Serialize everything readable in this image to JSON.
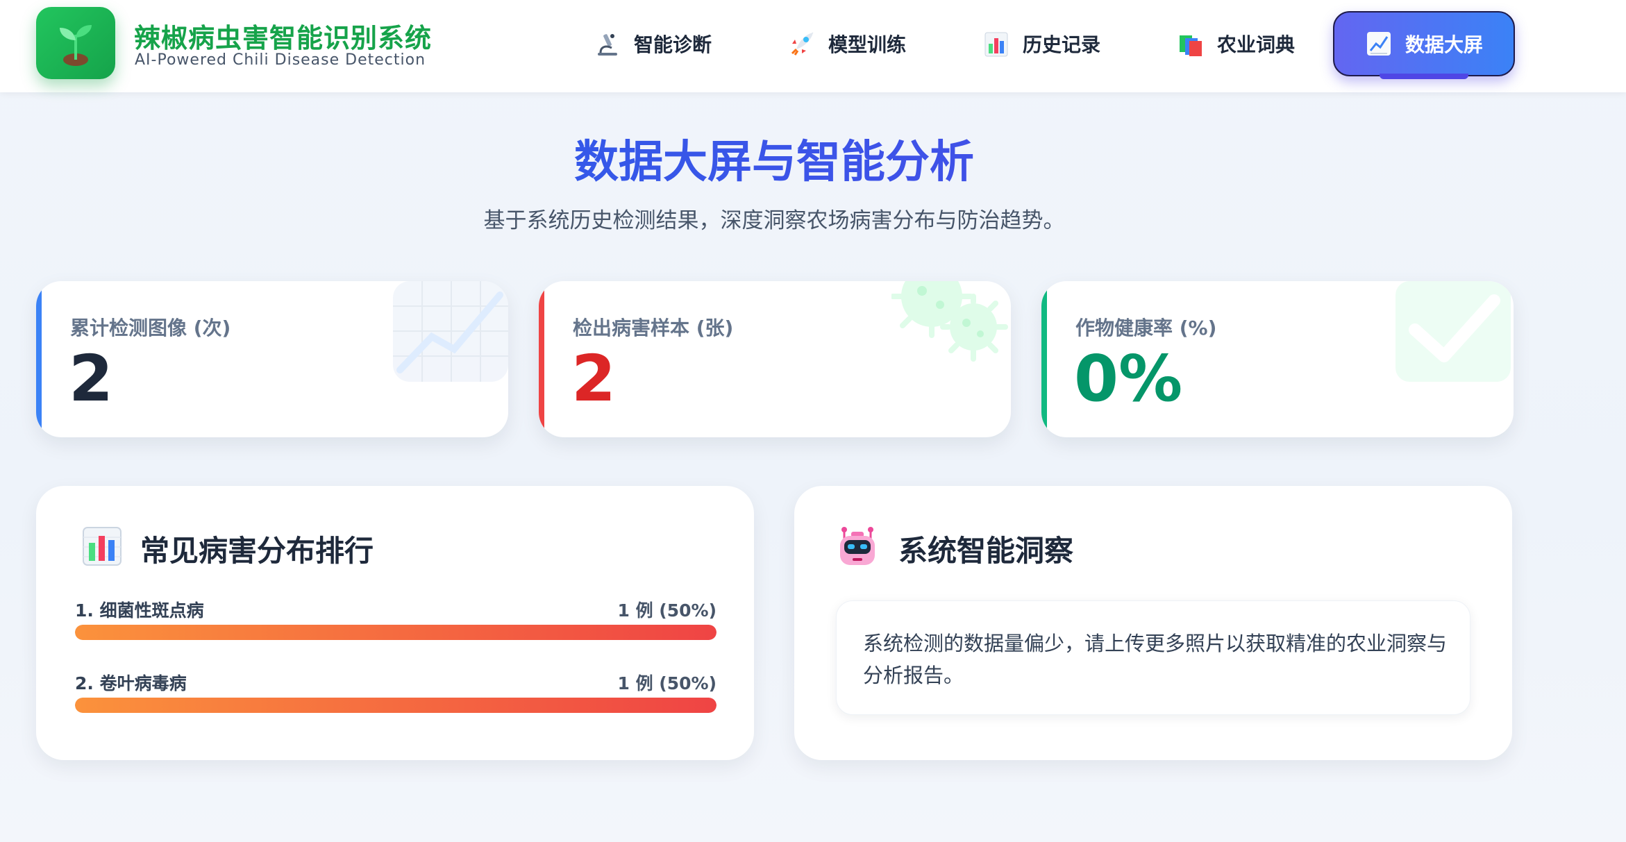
{
  "app": {
    "title": "辣椒病虫害智能识别系统",
    "subtitle": "AI-Powered Chili Disease Detection",
    "logo_icon": "seedling-icon"
  },
  "nav": {
    "items": [
      {
        "label": "智能诊断",
        "icon": "microscope-icon",
        "active": false
      },
      {
        "label": "模型训练",
        "icon": "rocket-icon",
        "active": false
      },
      {
        "label": "历史记录",
        "icon": "bar-chart-icon",
        "active": false
      },
      {
        "label": "农业词典",
        "icon": "books-icon",
        "active": false
      },
      {
        "label": "数据大屏",
        "icon": "trend-chart-icon",
        "active": true
      }
    ]
  },
  "page": {
    "title": "数据大屏与智能分析",
    "subtitle": "基于系统历史检测结果，深度洞察农场病害分布与防治趋势。"
  },
  "stats": [
    {
      "label": "累计检测图像 (次)",
      "value": "2",
      "color": "#1e293b",
      "accent": "#3b82f6",
      "icon": "trend-line-icon"
    },
    {
      "label": "检出病害样本 (张)",
      "value": "2",
      "color": "#dc2626",
      "accent": "#ef4444",
      "icon": "virus-icon"
    },
    {
      "label": "作物健康率 (%)",
      "value": "0%",
      "color": "#059669",
      "accent": "#10b981",
      "icon": "checkmark-icon"
    }
  ],
  "ranking": {
    "title": "常见病害分布排行",
    "icon": "bar-chart-icon",
    "items": [
      {
        "name": "1. 细菌性斑点病",
        "count": "1 例 (50%)",
        "fraction": 1.0
      },
      {
        "name": "2. 卷叶病毒病",
        "count": "1 例 (50%)",
        "fraction": 1.0
      }
    ]
  },
  "insight": {
    "title": "系统智能洞察",
    "icon": "robot-icon",
    "text": "系统检测的数据量偏少，请上传更多照片以获取精准的农业洞察与分析报告。"
  },
  "colors": {
    "brand_green": "#16a34a",
    "accent_blue": "#2563eb",
    "accent_indigo": "#4f46e5",
    "danger_red": "#dc2626",
    "success_green": "#059669"
  }
}
